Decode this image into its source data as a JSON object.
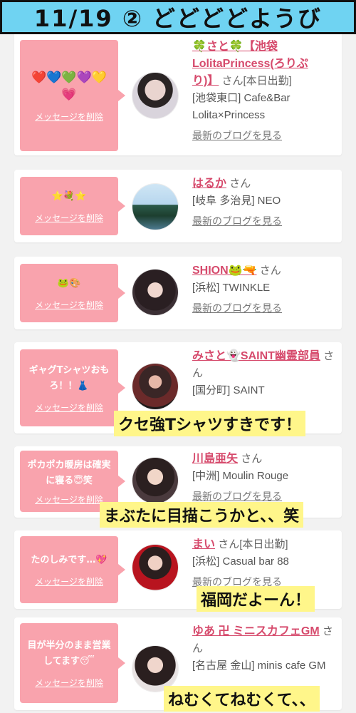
{
  "header": {
    "title": "11/19 ② どどどどようび"
  },
  "delete_label": "メッセージを削除",
  "blog_label": "最新のブログを見る",
  "cards": [
    {
      "message": "❤️💙💚💜💛💗",
      "name": "🍀さと🍀【池袋LolitaPrincess(ろりぷり)】",
      "san": "さん[本日出勤]",
      "location": "[池袋東口] Cafe&Bar Lolita×Princess"
    },
    {
      "message": "⭐💐⭐",
      "name": "はるか",
      "san": "さん",
      "location": "[岐阜 多治見] NEO"
    },
    {
      "message": "🐸🎨",
      "name": "SHION🐸🔫",
      "san": "さん",
      "location": "[浜松] TWINKLE"
    },
    {
      "message": "ギャグTシャツおもろ！！👗",
      "name": "みさと👻SAINT幽霊部員",
      "san": "さん",
      "location": "[国分町] SAINT"
    },
    {
      "message": "ポカポカ暖房は確実に寝る😇笑",
      "name": "川島亜矢",
      "san": "さん",
      "location": "[中洲] Moulin Rouge"
    },
    {
      "message": "たのしみです…💖",
      "name": "まい",
      "san": "さん[本日出勤]",
      "location": "[浜松] Casual bar 88"
    },
    {
      "message": "目が半分のまま営業してます😴",
      "name": "ゆあ 卍 ミニスカフェGM",
      "san": "さん",
      "location": "[名古屋 金山] minis cafe GM"
    }
  ],
  "captions": {
    "c1": "クセ強Tシャツすきです！",
    "c2": "まぶたに目描こうかと、、笑",
    "c3": "福岡だよーん！",
    "c4": "ねむくてねむくて、、"
  }
}
